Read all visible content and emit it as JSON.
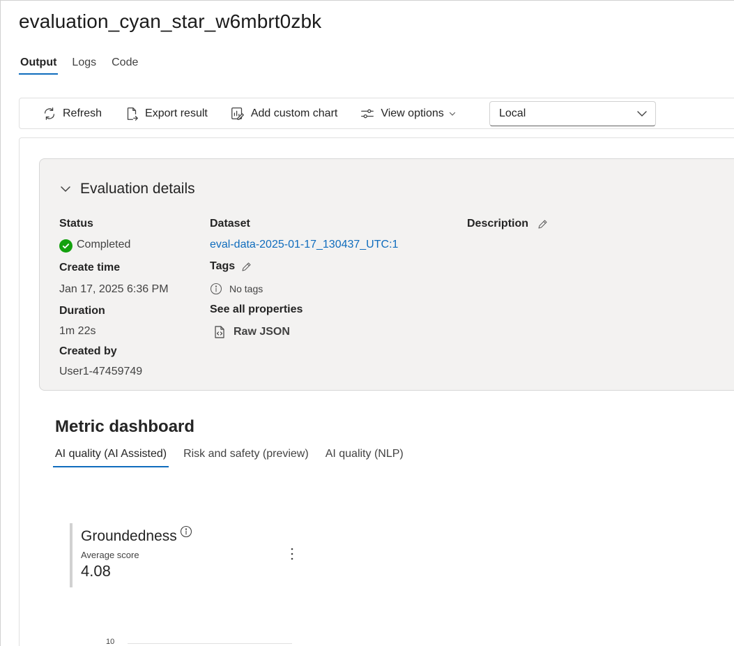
{
  "page": {
    "title": "evaluation_cyan_star_w6mbrt0zbk"
  },
  "tabs": [
    {
      "label": "Output",
      "active": true
    },
    {
      "label": "Logs",
      "active": false
    },
    {
      "label": "Code",
      "active": false
    }
  ],
  "toolbar": {
    "refresh_label": "Refresh",
    "export_label": "Export result",
    "add_chart_label": "Add custom chart",
    "view_options_label": "View options",
    "scope_select": {
      "selected": "Local"
    }
  },
  "details": {
    "header": "Evaluation details",
    "status": {
      "label": "Status",
      "value": "Completed",
      "color": "#13a10e"
    },
    "create_time": {
      "label": "Create time",
      "value": "Jan 17, 2025 6:36 PM"
    },
    "duration": {
      "label": "Duration",
      "value": "1m 22s"
    },
    "created_by": {
      "label": "Created by",
      "value": "User1-47459749"
    },
    "dataset": {
      "label": "Dataset",
      "value": "eval-data-2025-01-17_130437_UTC:1"
    },
    "tags": {
      "label": "Tags",
      "empty_text": "No tags"
    },
    "properties": {
      "label": "See all properties",
      "raw_json_label": "Raw JSON"
    },
    "description": {
      "label": "Description"
    }
  },
  "metrics": {
    "title": "Metric dashboard",
    "tabs": [
      {
        "label": "AI quality (AI Assisted)",
        "active": true
      },
      {
        "label": "Risk and safety (preview)",
        "active": false
      },
      {
        "label": "AI quality (NLP)",
        "active": false
      }
    ],
    "card": {
      "title": "Groundedness",
      "subtitle": "Average score",
      "value": "4.08"
    },
    "chart_axis_top_tick": "10"
  },
  "colors": {
    "accent": "#0f6cbd",
    "success": "#13a10e"
  }
}
